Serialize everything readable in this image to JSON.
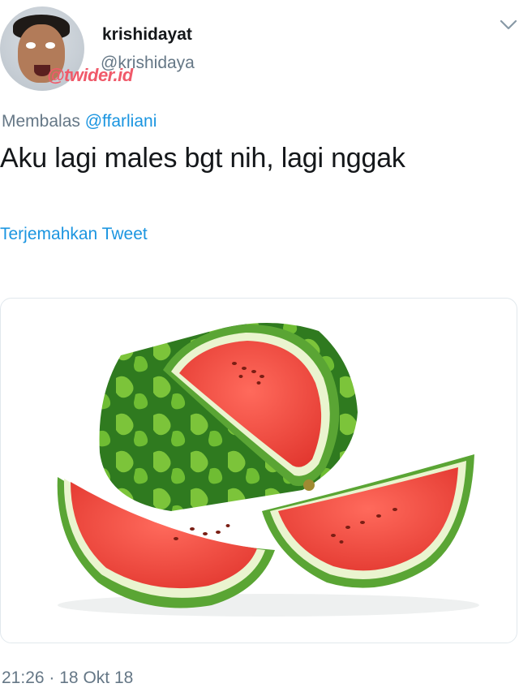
{
  "user": {
    "display_name": "krishidayat",
    "handle": "@krishidaya",
    "watermark": "@twider.id"
  },
  "reply": {
    "prefix": "Membalas",
    "mention": "@ffarliani"
  },
  "tweet": {
    "text": "Aku lagi males bgt nih, lagi nggak",
    "translate_label": "Terjemahkan Tweet",
    "time": "21:26",
    "separator": "·",
    "date": "18 Okt 18"
  },
  "icons": {
    "menu": "chevron-down-icon",
    "media": "watermelon-image"
  },
  "colors": {
    "link": "#1b95e0",
    "secondary": "#657786",
    "primary_text": "#14171a",
    "watermark": "#f05a6a"
  }
}
